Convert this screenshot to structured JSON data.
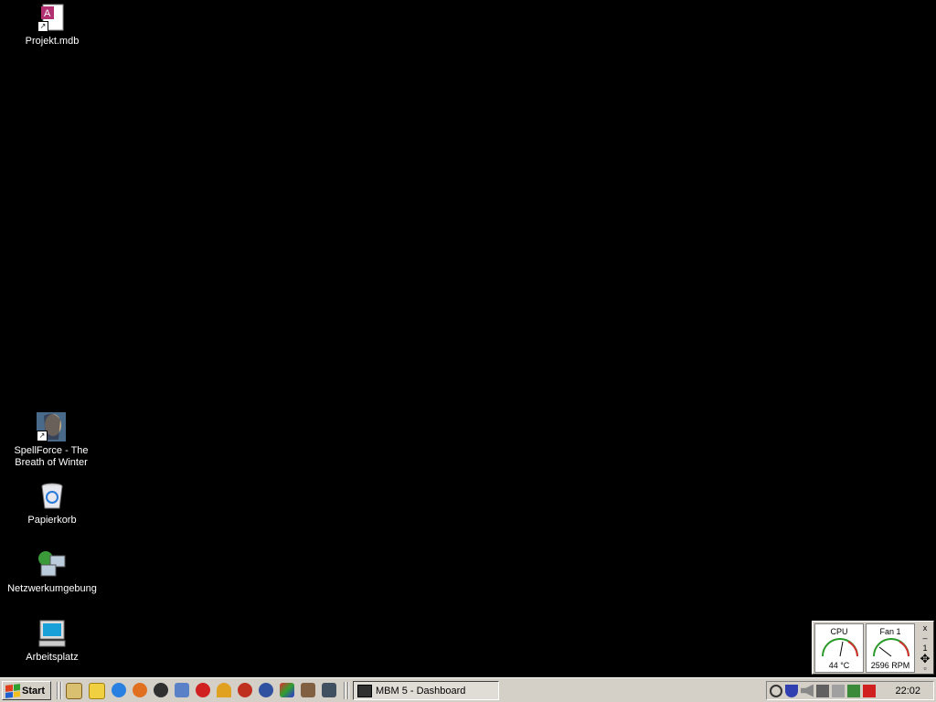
{
  "desktop": {
    "icons": [
      {
        "label": "Projekt.mdb",
        "icon": "access-database-icon"
      },
      {
        "label": "SpellForce - The Breath of Winter",
        "icon": "spellforce-icon"
      },
      {
        "label": "Papierkorb",
        "icon": "recycle-bin-icon"
      },
      {
        "label": "Netzwerkumgebung",
        "icon": "network-places-icon"
      },
      {
        "label": "Arbeitsplatz",
        "icon": "my-computer-icon"
      }
    ]
  },
  "dashboard": {
    "gauges": [
      {
        "title": "CPU",
        "value": "44 °C"
      },
      {
        "title": "Fan 1",
        "value": "2596 RPM"
      }
    ],
    "controls": {
      "close": "x",
      "minus": "–",
      "page": "1"
    }
  },
  "taskbar": {
    "start_label": "Start",
    "quick_launch": [
      "show-desktop-icon",
      "notes-icon",
      "internet-explorer-icon",
      "firefox-icon",
      "app-icon",
      "messenger-icon",
      "flash-icon",
      "sun-icon",
      "browser-icon",
      "tool-icon",
      "palette-icon",
      "paint-icon",
      "security-icon"
    ],
    "task": {
      "label": "MBM 5 - Dashboard"
    },
    "clock": "22:02"
  }
}
